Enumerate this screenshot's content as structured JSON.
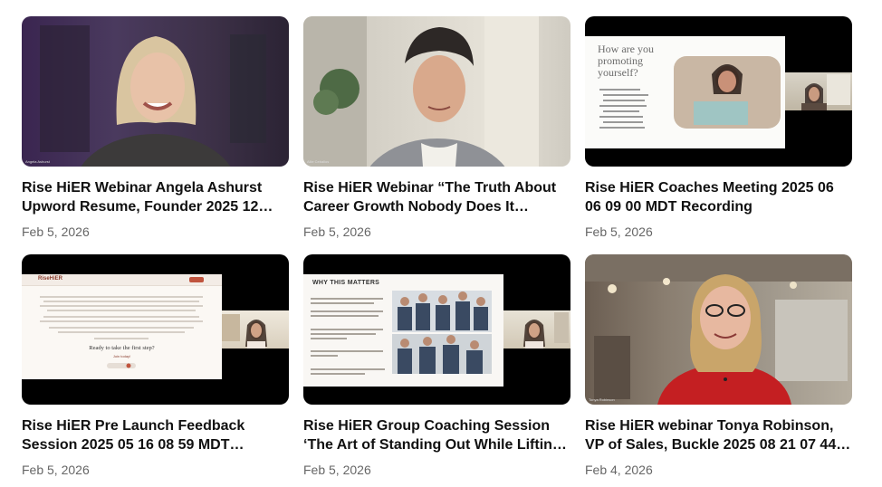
{
  "videos": [
    {
      "title": "Rise HiER Webinar Angela Ashurst Upword Resume, Founder 2025 12 11…",
      "date": "Feb 5, 2026",
      "speaker_tag": "Angela Ashurst"
    },
    {
      "title": "Rise HiER Webinar “The Truth About Career Growth Nobody Does It Alone…",
      "date": "Feb 5, 2026",
      "speaker_tag": "Allie Ceballos"
    },
    {
      "title": "Rise HiER Coaches Meeting 2025 06 06 09 00 MDT Recording",
      "date": "Feb 5, 2026",
      "slide_title": "How are you promoting yourself?"
    },
    {
      "title": "Rise HiER Pre Launch Feedback Session 2025 05 16 08 59 MDT…",
      "date": "Feb 5, 2026",
      "slide_heading": "Ready to take the first step?",
      "slide_cta": "Join today!",
      "logo": "RiseHiER"
    },
    {
      "title": "Rise HiER Group Coaching Session ‘The Art of Standing Out While Liftin…",
      "date": "Feb 5, 2026",
      "slide_title": "WHY THIS MATTERS"
    },
    {
      "title": "Rise HiER webinar Tonya Robinson, VP of Sales, Buckle 2025 08 21 07 44…",
      "date": "Feb 4, 2026",
      "speaker_tag": "Tonya Robinson"
    }
  ]
}
